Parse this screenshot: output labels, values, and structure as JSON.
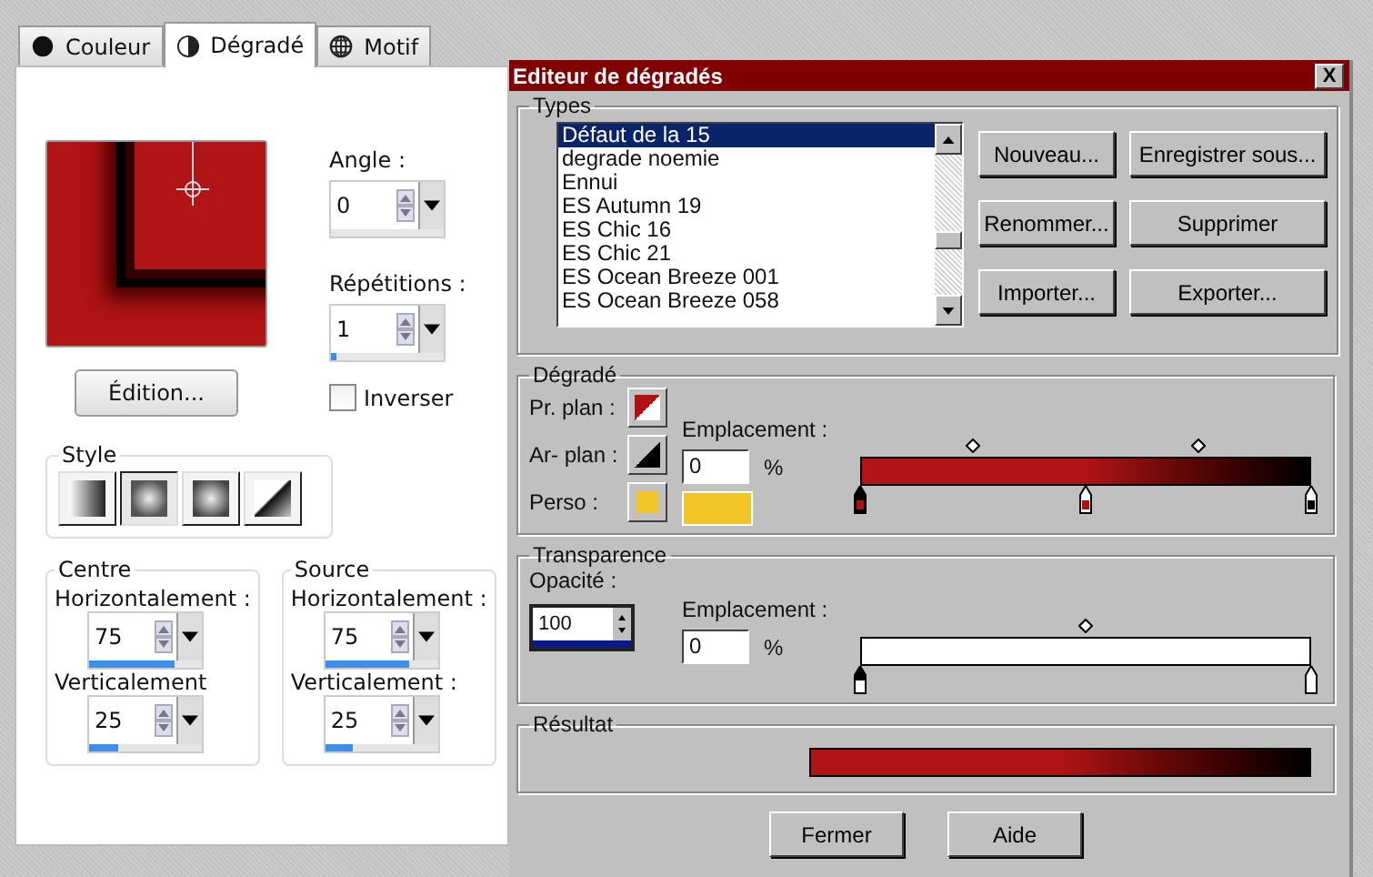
{
  "tabs": [
    {
      "label": "Couleur",
      "selected": false
    },
    {
      "label": "Dégradé",
      "selected": true
    },
    {
      "label": "Motif",
      "selected": false
    }
  ],
  "angle": {
    "label": "Angle :",
    "value": "0"
  },
  "repetitions": {
    "label": "Répétitions :",
    "value": "1",
    "level": 0.05
  },
  "edit_button": "Édition...",
  "invert": {
    "label": "Inverser",
    "checked": false
  },
  "style": {
    "title": "Style",
    "options": [
      {
        "kind": "linear",
        "selected": false
      },
      {
        "kind": "rectangular",
        "selected": true
      },
      {
        "kind": "radial",
        "selected": false
      },
      {
        "kind": "corner",
        "selected": false
      }
    ]
  },
  "centre": {
    "title": "Centre",
    "horizontal": {
      "label": "Horizontalement :",
      "value": "75",
      "level": 0.75
    },
    "vertical": {
      "label": "Verticalement",
      "value": "25",
      "level": 0.25
    }
  },
  "source": {
    "title": "Source",
    "horizontal": {
      "label": "Horizontalement :",
      "value": "75",
      "level": 0.75
    },
    "vertical": {
      "label": "Verticalement :",
      "value": "25",
      "level": 0.25
    }
  },
  "editor": {
    "title": "Editeur de dégradés",
    "close": "X",
    "types": {
      "title": "Types",
      "items": [
        {
          "label": "Défaut de la 15",
          "selected": true
        },
        {
          "label": "degrade noemie",
          "selected": false
        },
        {
          "label": "Ennui",
          "selected": false
        },
        {
          "label": "ES Autumn 19",
          "selected": false
        },
        {
          "label": "ES Chic 16",
          "selected": false
        },
        {
          "label": "ES Chic 21",
          "selected": false
        },
        {
          "label": "ES Ocean Breeze 001",
          "selected": false
        },
        {
          "label": "ES Ocean Breeze 058",
          "selected": false
        }
      ],
      "buttons": [
        "Nouveau...",
        "Enregistrer sous...",
        "Renommer...",
        "Supprimer",
        "Importer...",
        "Exporter..."
      ]
    },
    "gradient": {
      "title": "Dégradé",
      "foreground_label": "Pr. plan :",
      "background_label": "Ar- plan :",
      "custom_label": "Perso :",
      "location_label": "Emplacement :",
      "location": "0",
      "unit": "%"
    },
    "transparency": {
      "title": "Transparence",
      "opacity_label": "Opacité :",
      "opacity": {
        "value": "100",
        "level": 1
      },
      "location_label": "Emplacement :",
      "location": "0",
      "unit": "%"
    },
    "result": {
      "title": "Résultat"
    },
    "buttons": [
      "Fermer",
      "Aide"
    ]
  }
}
